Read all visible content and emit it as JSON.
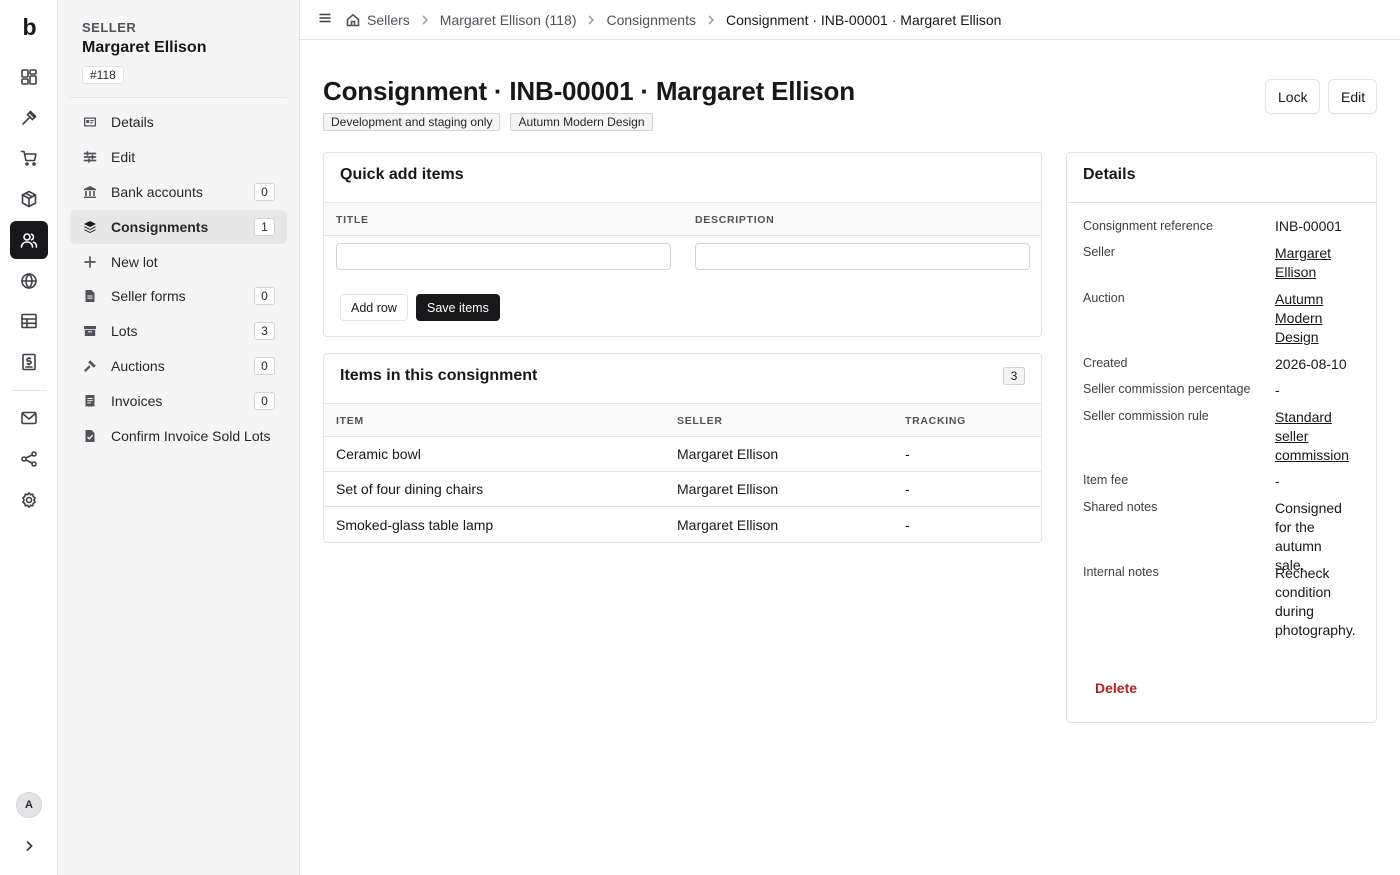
{
  "app": {
    "logo": "b",
    "avatar_initial": "A"
  },
  "sidebar": {
    "eyebrow": "SELLER",
    "name": "Margaret Ellison",
    "id_badge": "#118",
    "items": [
      {
        "label": "Details",
        "count": null
      },
      {
        "label": "Edit",
        "count": null
      },
      {
        "label": "Bank accounts",
        "count": "0"
      },
      {
        "label": "Consignments",
        "count": "1",
        "active": true
      },
      {
        "label": "New lot",
        "count": null
      },
      {
        "label": "Seller forms",
        "count": "0"
      },
      {
        "label": "Lots",
        "count": "3"
      },
      {
        "label": "Auctions",
        "count": "0"
      },
      {
        "label": "Invoices",
        "count": "0"
      },
      {
        "label": "Confirm Invoice Sold Lots",
        "count": null
      }
    ]
  },
  "breadcrumb": [
    "Sellers",
    "Margaret Ellison (118)",
    "Consignments",
    "Consignment · INB-00001 · Margaret Ellison"
  ],
  "page": {
    "title": "Consignment · INB-00001 · Margaret Ellison",
    "tags": [
      "Development and staging only",
      "Autumn Modern Design"
    ],
    "lock_label": "Lock",
    "edit_label": "Edit"
  },
  "quick_add": {
    "title": "Quick add items",
    "col_title": "TITLE",
    "col_description": "DESCRIPTION",
    "title_value": "",
    "description_value": "",
    "add_row_label": "Add row",
    "save_label": "Save items"
  },
  "items": {
    "title": "Items in this consignment",
    "count": "3",
    "columns": [
      "ITEM",
      "SELLER",
      "TRACKING"
    ],
    "rows": [
      {
        "item": "Ceramic bowl",
        "seller": "Margaret Ellison",
        "tracking": "-"
      },
      {
        "item": "Set of four dining chairs",
        "seller": "Margaret Ellison",
        "tracking": "-"
      },
      {
        "item": "Smoked-glass table lamp",
        "seller": "Margaret Ellison",
        "tracking": "-"
      }
    ]
  },
  "details": {
    "title": "Details",
    "fields": [
      {
        "label": "Consignment reference",
        "value": "INB-00001"
      },
      {
        "label": "Seller",
        "value": "Margaret Ellison"
      },
      {
        "label": "Auction",
        "value": "Autumn Modern Design"
      },
      {
        "label": "Created",
        "value": "2026-08-10"
      },
      {
        "label": "Seller commission percentage",
        "value": "-"
      },
      {
        "label": "Seller commission rule",
        "value": "Standard seller commission"
      },
      {
        "label": "Item fee",
        "value": "-"
      },
      {
        "label": "Shared notes",
        "value": "Consigned for the autumn sale."
      },
      {
        "label": "Internal notes",
        "value": "Recheck condition during photography."
      }
    ],
    "delete_label": "Delete"
  },
  "colors": {
    "accent": "#18181b",
    "danger": "#b91c1c",
    "sidebar_bg": "#f5f5f5",
    "border": "#e4e4e7"
  }
}
